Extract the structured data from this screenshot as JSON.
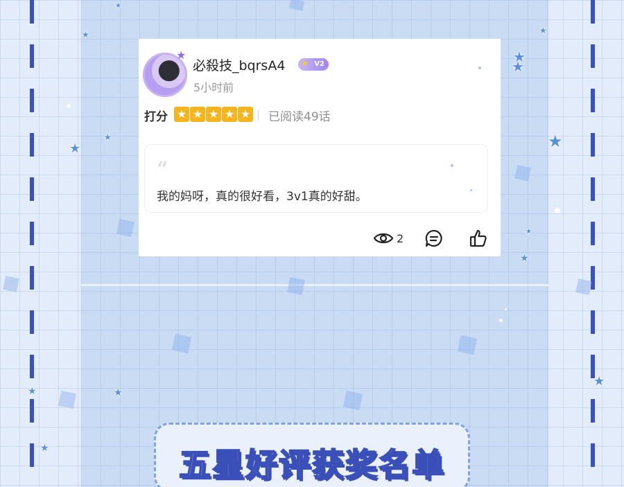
{
  "review": {
    "username": "必殺技_bqrsA4",
    "vip_level": "V2",
    "time_ago": "5小时前",
    "rating_label": "打分",
    "rating": 5,
    "rating_max": 5,
    "star_glyph": "★",
    "read_status": "已阅读49话",
    "quote_glyph": "“",
    "comment": "我的妈呀，真的很好看，3v1真的好甜。",
    "view_count": "2"
  },
  "banner": {
    "title": "五星好评获奖名单"
  },
  "colors": {
    "accent": "#3d4fc0",
    "star": "#f6b51c",
    "vip": "#9f86ee",
    "panel": "#c9dcf4",
    "background": "#e3ecfa"
  },
  "icons": [
    "eye-icon",
    "comment-icon",
    "thumbs-up-icon",
    "crown-icon",
    "sparkle-star-icon"
  ]
}
